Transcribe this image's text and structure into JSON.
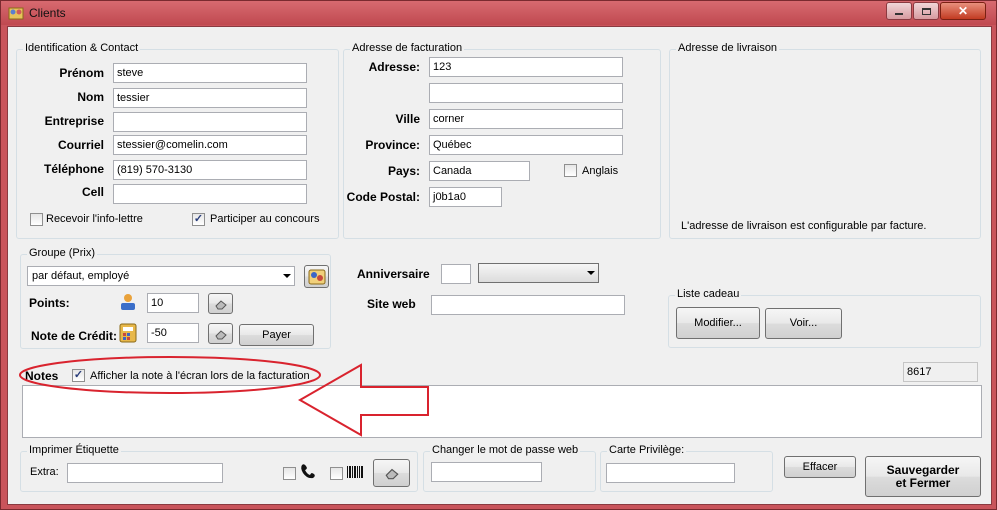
{
  "window": {
    "title": "Clients"
  },
  "identification": {
    "group_title": "Identification & Contact",
    "prenom_label": "Prénom",
    "prenom_value": "steve",
    "nom_label": "Nom",
    "nom_value": "tessier",
    "entreprise_label": "Entreprise",
    "entreprise_value": "",
    "courriel_label": "Courriel",
    "courriel_value": "stessier@comelin.com",
    "telephone_label": "Téléphone",
    "telephone_value": "(819) 570-3130",
    "cell_label": "Cell",
    "cell_value": "",
    "newsletter_label": "Recevoir l'info-lettre",
    "newsletter_checked": false,
    "concours_label": "Participer au concours",
    "concours_checked": true
  },
  "facturation": {
    "group_title": "Adresse de facturation",
    "adresse_label": "Adresse:",
    "adresse_value": "123",
    "adresse2_value": "",
    "ville_label": "Ville",
    "ville_value": "corner",
    "province_label": "Province:",
    "province_value": "Québec",
    "pays_label": "Pays:",
    "pays_value": "Canada",
    "anglais_label": "Anglais",
    "anglais_checked": false,
    "code_postal_label": "Code Postal:",
    "code_postal_value": "j0b1a0"
  },
  "livraison": {
    "group_title": "Adresse de livraison",
    "note": "L'adresse de livraison est configurable par facture."
  },
  "groupe": {
    "group_title": "Groupe (Prix)",
    "selected": "par défaut, employé",
    "points_label": "Points:",
    "points_value": "10",
    "credit_label": "Note de Crédit:",
    "credit_value": "-50",
    "payer_label": "Payer"
  },
  "misc": {
    "anniversaire_label": "Anniversaire",
    "anniversaire_day": "",
    "anniversaire_month": "",
    "site_web_label": "Site web",
    "site_web_value": ""
  },
  "liste_cadeau": {
    "group_title": "Liste cadeau",
    "modifier_label": "Modifier...",
    "voir_label": "Voir..."
  },
  "notes": {
    "label": "Notes",
    "show_on_invoice_label": "Afficher la note à l'écran lors de la facturation",
    "show_on_invoice_checked": true,
    "client_id": "8617",
    "text": ""
  },
  "etiquette": {
    "group_title": "Imprimer Étiquette",
    "extra_label": "Extra:",
    "extra_value": ""
  },
  "mot_de_passe": {
    "group_title": "Changer le mot de passe web",
    "value": ""
  },
  "carte": {
    "group_title": "Carte Privilège:",
    "value": ""
  },
  "actions": {
    "effacer_label": "Effacer",
    "save_close_label_1": "Sauvegarder",
    "save_close_label_2": "et Fermer"
  },
  "colors": {
    "window_frame": "#c9545b",
    "annotation_red": "#d9232e",
    "client_bg": "#f0f0f0"
  }
}
